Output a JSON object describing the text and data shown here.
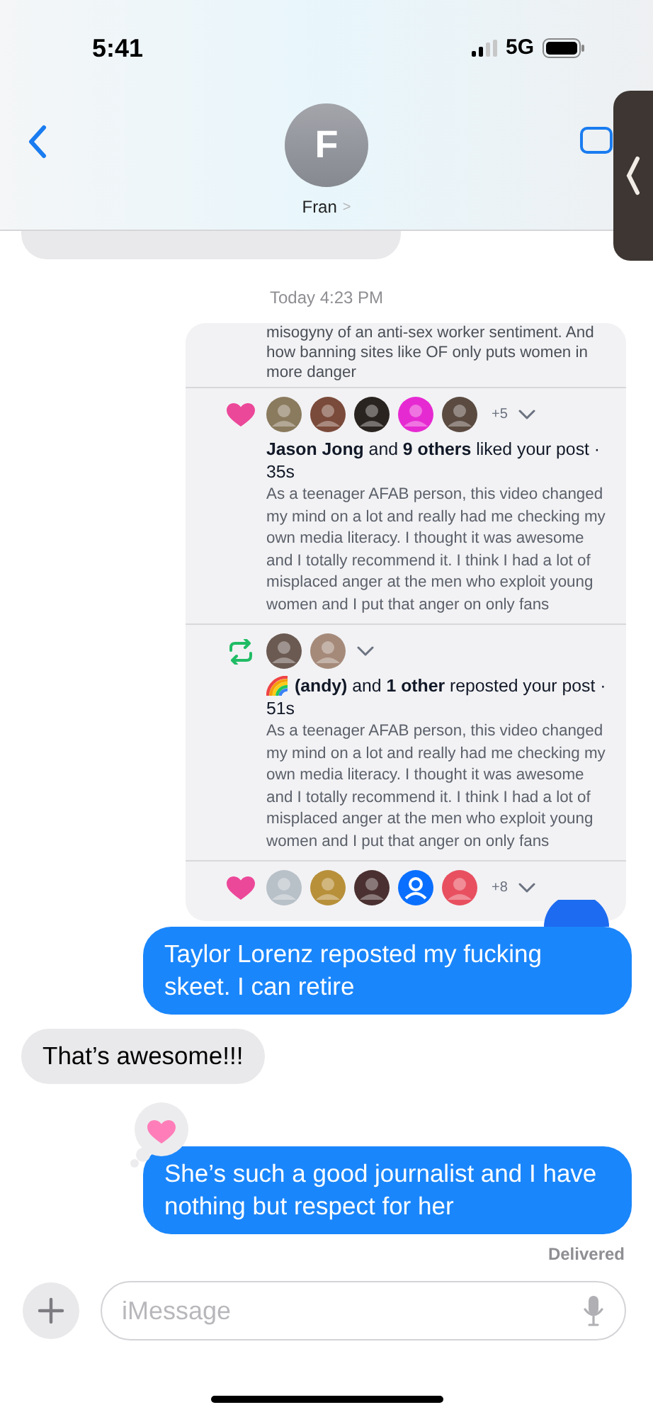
{
  "status_bar": {
    "time": "5:41",
    "network": "5G"
  },
  "header": {
    "avatar_initial": "F",
    "contact_name": "Fran",
    "contact_chevron": ">"
  },
  "timestamp": "Today 4:23 PM",
  "shared_screenshot": {
    "top_text": "misogyny of an anti-sex worker sentiment. And how banning sites like OF only puts women in more danger",
    "notifications": [
      {
        "kind": "like",
        "avatars": [
          {
            "kind": "photo"
          },
          {
            "kind": "photo"
          },
          {
            "kind": "photo"
          },
          {
            "kind": "photo"
          },
          {
            "kind": "photo"
          }
        ],
        "more": "+5",
        "headline": "**Jason Jong** and **9 others** liked your post · 35s",
        "body": "As a teenager AFAB person, this video changed my mind on a lot and really had me checking my own media literacy. I thought it was awesome and I totally recommend it. I think I had a lot of misplaced anger at the men who exploit young women and I put that anger on only fans"
      },
      {
        "kind": "repost",
        "avatars": [
          {
            "kind": "photo"
          },
          {
            "kind": "photo"
          }
        ],
        "headline": "**(andy)** and **1 other** reposted your post · 51s",
        "emoji": true,
        "body": "As a teenager AFAB person, this video changed my mind on a lot and really had me checking my own media literacy. I thought it was awesome and I totally recommend it. I think I had a lot of misplaced anger at the men who exploit young women and I put that anger on only fans"
      },
      {
        "kind": "like",
        "avatars": [
          {
            "kind": "photo"
          },
          {
            "kind": "photo"
          },
          {
            "kind": "photo"
          },
          {
            "kind": "default"
          },
          {
            "kind": "photo"
          }
        ],
        "more": "+8"
      }
    ]
  },
  "messages": [
    {
      "kind": "sent",
      "text": "Taylor Lorenz reposted my fucking skeet. I can retire"
    },
    {
      "kind": "received",
      "text": "That’s awesome!!!"
    },
    {
      "kind": "sent",
      "text": "She’s such a good journalist and I have nothing but respect for her",
      "tapback": true
    }
  ],
  "delivery_status": "Delivered",
  "composer": {
    "placeholder": "iMessage"
  }
}
